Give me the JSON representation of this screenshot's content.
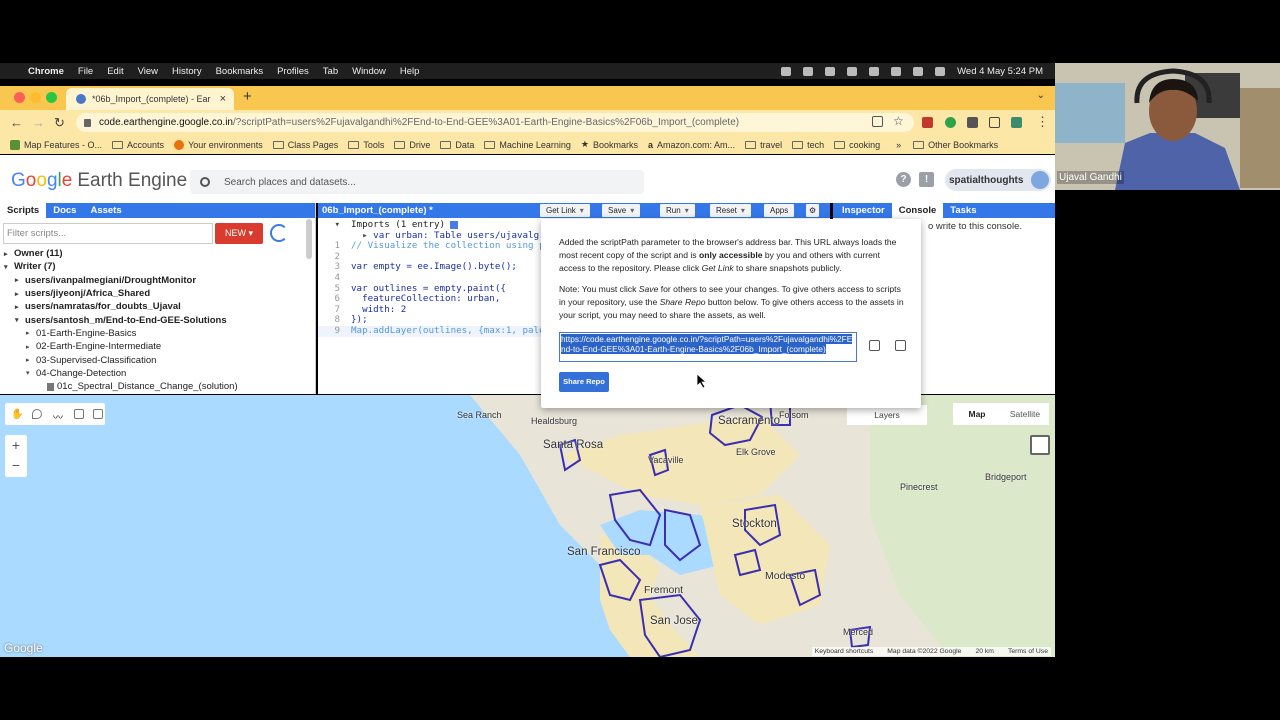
{
  "menubar": {
    "apple": "",
    "app": "Chrome",
    "items": [
      "File",
      "Edit",
      "View",
      "History",
      "Bookmarks",
      "Profiles",
      "Tab",
      "Window",
      "Help"
    ],
    "datetime": "Wed 4 May  5:24 PM"
  },
  "browser": {
    "tab_title": "*06b_Import_(complete) - Ear",
    "url_host": "code.earthengine.google.co.in",
    "url_path": "/?scriptPath=users%2Fujavalgandhi%2FEnd-to-End-GEE%3A01-Earth-Engine-Basics%2F06b_Import_(complete)",
    "bookmarks": [
      "Map Features - O...",
      "Accounts",
      "Your environments",
      "Class Pages",
      "Tools",
      "Drive",
      "Data",
      "Machine Learning",
      "Bookmarks",
      "Amazon.com: Am...",
      "travel",
      "tech",
      "cooking"
    ],
    "more": "»",
    "other_bookmarks": "Other Bookmarks"
  },
  "gee": {
    "logo_g": [
      "G",
      "o",
      "o",
      "g",
      "l",
      "e"
    ],
    "logo_rest": "Earth Engine",
    "search_placeholder": "Search places and datasets...",
    "user": "spatialthoughts",
    "left_tabs": [
      "Scripts",
      "Docs",
      "Assets"
    ],
    "filter_placeholder": "Filter scripts...",
    "new_label": "NEW ▾",
    "tree": [
      {
        "label": "Owner (11)",
        "caret": "▸",
        "indent": 0,
        "bold": true
      },
      {
        "label": "Writer (7)",
        "caret": "▾",
        "indent": 0,
        "bold": true
      },
      {
        "label": "users/ivanpalmegiani/DroughtMonitor",
        "caret": "▸",
        "indent": 1,
        "bold": true
      },
      {
        "label": "users/jiyeonj/Africa_Shared",
        "caret": "▸",
        "indent": 1,
        "bold": true
      },
      {
        "label": "users/namratas/for_doubts_Ujaval",
        "caret": "▸",
        "indent": 1,
        "bold": true
      },
      {
        "label": "users/santosh_m/End-to-End-GEE-Solutions",
        "caret": "▾",
        "indent": 1,
        "bold": true
      },
      {
        "label": "01-Earth-Engine-Basics",
        "caret": "▸",
        "indent": 2,
        "bold": false
      },
      {
        "label": "02-Earth-Engine-Intermediate",
        "caret": "▸",
        "indent": 2,
        "bold": false
      },
      {
        "label": "03-Supervised-Classification",
        "caret": "▸",
        "indent": 2,
        "bold": false
      },
      {
        "label": "04-Change-Detection",
        "caret": "▾",
        "indent": 2,
        "bold": false
      },
      {
        "label": "01c_Spectral_Distance_Change_(solution)",
        "caret": "",
        "indent": 3,
        "bold": false,
        "file": true
      }
    ],
    "script_name": "06b_Import_(complete) *",
    "editor_buttons": [
      {
        "label": "Get Link",
        "dd": "▾"
      },
      {
        "label": "Save",
        "dd": "▾"
      },
      {
        "label": "Run",
        "dd": "▾"
      },
      {
        "label": "Reset",
        "dd": "▾"
      },
      {
        "label": "Apps",
        "dd": ""
      }
    ],
    "right_tabs": [
      "Inspector",
      "Console",
      "Tasks"
    ],
    "console_msg": "o write to this console."
  },
  "code": {
    "imports": "Imports (1 entry)",
    "import_line": "var urban: Table users/ujavalg",
    "lines": [
      {
        "n": "1",
        "t": "// Visualize the collection using p"
      },
      {
        "n": "2",
        "t": ""
      },
      {
        "n": "3",
        "t": "var empty = ee.Image().byte();"
      },
      {
        "n": "4",
        "t": ""
      },
      {
        "n": "5",
        "t": "var outlines = empty.paint({"
      },
      {
        "n": "6",
        "t": "  featureCollection: urban,"
      },
      {
        "n": "7",
        "t": "  width: 2"
      },
      {
        "n": "8",
        "t": "});"
      },
      {
        "n": "9",
        "t": "Map.addLayer(outlines, {max:1, pale"
      }
    ]
  },
  "popup": {
    "p1a": "Added the scriptPath parameter to the browser's address bar. This URL always loads the most recent copy of the script and is ",
    "p1b": "only accessible",
    "p1c": " by you and others with current access to the repository. Please click ",
    "p1d": "Get Link",
    "p1e": " to share snapshots publicly.",
    "p2a": "Note: You must click ",
    "p2b": "Save",
    "p2c": " for others to see your changes. To give others access to scripts in your repository, use the ",
    "p2d": "Share Repo",
    "p2e": " button below. To give others access to the assets in your script, you may need to share the assets, as well.",
    "url": "https://code.earthengine.google.co.in/?scriptPath=users%2Fujavalgandhi%2FEnd-to-End-GEE%3A01-Earth-Engine-Basics%2F06b_Import_(complete)",
    "share_repo": "Share Repo"
  },
  "map": {
    "layers": "Layers",
    "map_btn": "Map",
    "satellite_btn": "Satellite",
    "zoom_in": "+",
    "zoom_out": "−",
    "google": "Google",
    "attrib": [
      "Keyboard shortcuts",
      "Map data ©2022 Google",
      "20 km",
      "Terms of Use"
    ],
    "cities": [
      "Sea Ranch",
      "Healdsburg",
      "Santa Rosa",
      "Sacramento",
      "Folsom",
      "Elk Grove",
      "Vacaville",
      "Stockton",
      "San Francisco",
      "Fremont",
      "Modesto",
      "San Jose",
      "Pinecrest",
      "Bridgeport",
      "Merced"
    ]
  },
  "webcam": {
    "name": "Ujaval Gandhi"
  }
}
